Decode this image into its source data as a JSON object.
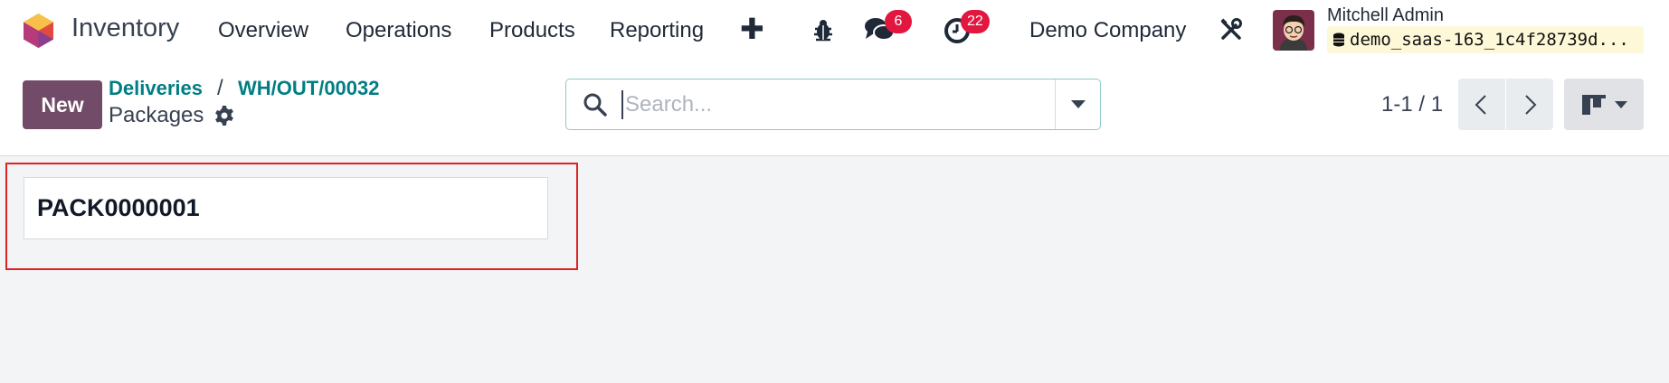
{
  "app": {
    "name": "Inventory"
  },
  "menu": [
    {
      "label": "Overview"
    },
    {
      "label": "Operations"
    },
    {
      "label": "Products"
    },
    {
      "label": "Reporting"
    }
  ],
  "systray": {
    "messages_count": "6",
    "activities_count": "22",
    "company": "Demo Company",
    "user_name": "Mitchell Admin",
    "database": "demo_saas-163_1c4f28739d..."
  },
  "control": {
    "new_label": "New",
    "breadcrumbs": [
      "Deliveries",
      "WH/OUT/00032"
    ],
    "breadcrumb_separator": "/",
    "title": "Packages",
    "search_placeholder": "Search...",
    "pager": "1-1 / 1"
  },
  "records": [
    {
      "name": "PACK0000001"
    }
  ],
  "colors": {
    "brand": "#714b67",
    "link": "#017e84",
    "badge": "#e1173f",
    "highlight": "#e02222"
  }
}
